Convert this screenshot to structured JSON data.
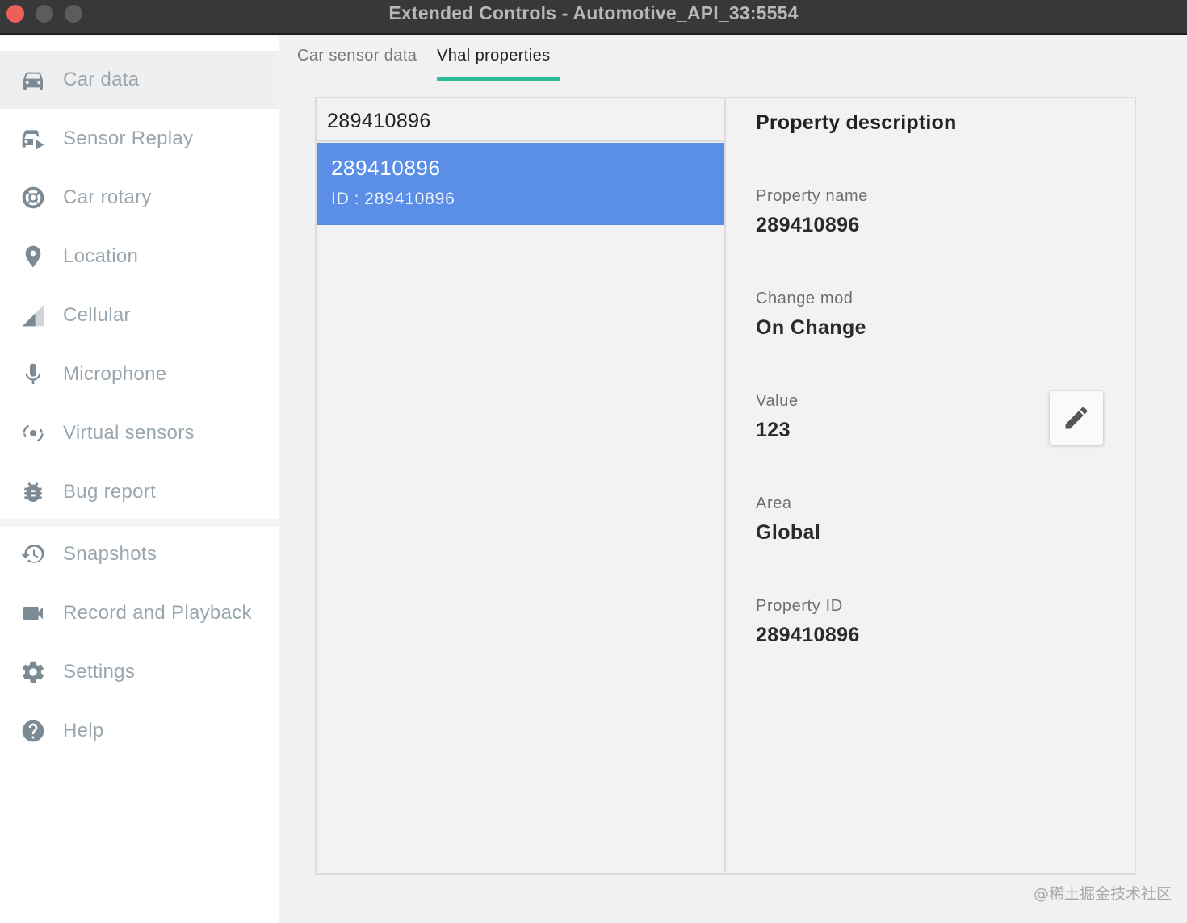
{
  "window": {
    "title": "Extended Controls - Automotive_API_33:5554"
  },
  "sidebar": {
    "items": [
      {
        "label": "Car data",
        "icon": "car-icon",
        "active": true
      },
      {
        "label": "Sensor Replay",
        "icon": "sensor-replay-icon"
      },
      {
        "label": "Car rotary",
        "icon": "rotary-icon"
      },
      {
        "label": "Location",
        "icon": "location-pin-icon"
      },
      {
        "label": "Cellular",
        "icon": "cellular-signal-icon"
      },
      {
        "label": "Microphone",
        "icon": "microphone-icon"
      },
      {
        "label": "Virtual sensors",
        "icon": "virtual-sensors-icon"
      },
      {
        "label": "Bug report",
        "icon": "bug-icon"
      },
      {
        "label": "Snapshots",
        "icon": "history-icon"
      },
      {
        "label": "Record and Playback",
        "icon": "videocam-icon"
      },
      {
        "label": "Settings",
        "icon": "gear-icon"
      },
      {
        "label": "Help",
        "icon": "help-icon"
      }
    ]
  },
  "tabs": [
    {
      "label": "Car sensor data",
      "active": false
    },
    {
      "label": "Vhal properties",
      "active": true
    }
  ],
  "list": {
    "header": "289410896",
    "rows": [
      {
        "title": "289410896",
        "id_label": "ID",
        "id_sep": ":",
        "id_value": "289410896",
        "selected": true
      }
    ]
  },
  "description": {
    "title": "Property description",
    "fields": [
      {
        "label": "Property name",
        "value": "289410896"
      },
      {
        "label": "Change mod",
        "value": "On Change"
      },
      {
        "label": "Value",
        "value": "123"
      },
      {
        "label": "Area",
        "value": "Global"
      },
      {
        "label": "Property ID",
        "value": "289410896"
      }
    ],
    "edit_icon": "pencil-icon"
  },
  "watermark": "@稀土掘金技术社区",
  "colors": {
    "accent_tab": "#2bb99a",
    "selected_row": "#5b8ee6",
    "titlebar": "#37383a",
    "close_button": "#ee5f57"
  }
}
